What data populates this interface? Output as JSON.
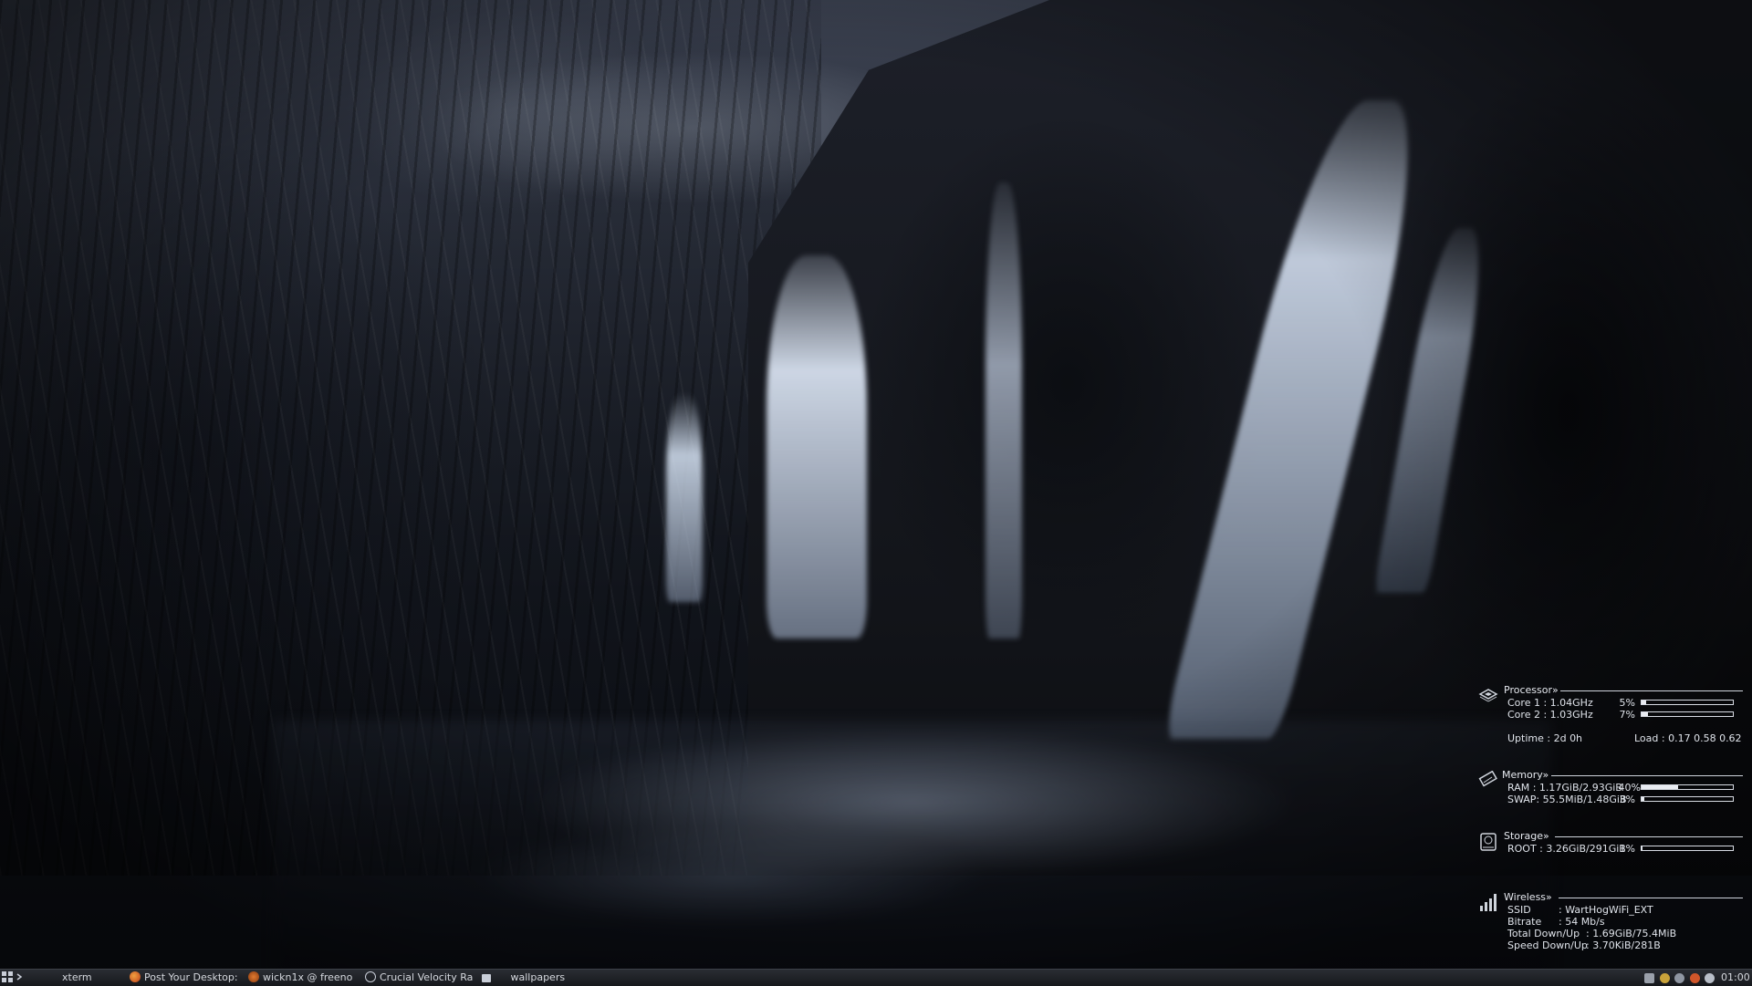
{
  "conky": {
    "processor": {
      "title": "Processor»",
      "core1": {
        "label": "Core 1 : 1.04GHz",
        "percent": "5%",
        "level": 0.05
      },
      "core2": {
        "label": "Core 2 : 1.03GHz",
        "percent": "7%",
        "level": 0.07
      },
      "uptime": "Uptime : 2d 0h",
      "load": "Load : 0.17 0.58 0.62"
    },
    "memory": {
      "title": "Memory»",
      "ram": {
        "label": "RAM : 1.17GiB/2.93GiB",
        "percent": "40%",
        "level": 0.4
      },
      "swap": {
        "label": "SWAP: 55.5MiB/1.48GiB",
        "percent": "3%",
        "level": 0.03
      }
    },
    "storage": {
      "title": "Storage»",
      "root": {
        "label": "ROOT : 3.26GiB/291GiB",
        "percent": "1%",
        "level": 0.01
      }
    },
    "wireless": {
      "title": "Wireless»",
      "ssid_label": "SSID",
      "ssid_value": ": WartHogWiFi_EXT",
      "bitrate_label": "Bitrate",
      "bitrate_value": ": 54 Mb/s",
      "total_label": "Total Down/Up",
      "total_value": ": 1.69GiB/75.4MiB",
      "speed_label": "Speed Down/Up",
      "speed_value": ": 3.70KiB/281B"
    },
    "icons": [
      "cpu-chip-icon",
      "memory-stick-icon",
      "hard-disk-icon",
      "signal-bars-icon"
    ]
  },
  "taskbar": {
    "items": [
      {
        "label": "xterm",
        "icon": "terminal-icon"
      },
      {
        "label": "Post Your Desktop:",
        "icon": "firefox-icon"
      },
      {
        "label": "wickn1x @ freeno",
        "icon": "chat-icon"
      },
      {
        "label": "Crucial Velocity Ra",
        "icon": "browser-icon"
      },
      {
        "label": "wallpapers",
        "icon": "folder-icon"
      }
    ],
    "clock": "01:00",
    "tray_icons": [
      "volume-icon",
      "network-icon",
      "power-icon",
      "notification-icon",
      "settings-icon"
    ]
  }
}
